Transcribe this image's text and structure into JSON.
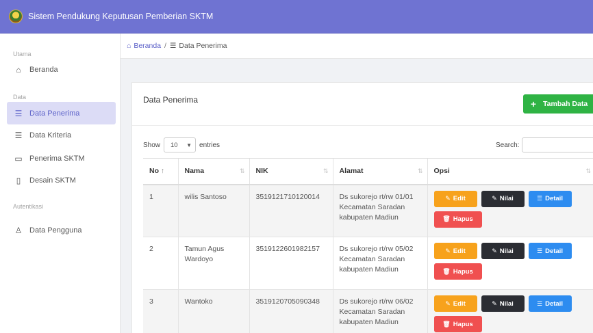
{
  "header": {
    "app_title": "Sistem Pendukung Keputusan Pemberian SKTM"
  },
  "sidebar": {
    "section_main": "Utama",
    "section_data": "Data",
    "section_auth": "Autentikasi",
    "items": [
      {
        "label": "Beranda",
        "icon": "home-icon"
      },
      {
        "label": "Data Penerima",
        "icon": "list-icon",
        "active": true
      },
      {
        "label": "Data Kriteria",
        "icon": "list-icon"
      },
      {
        "label": "Penerima SKTM",
        "icon": "calendar-icon"
      },
      {
        "label": "Desain SKTM",
        "icon": "file-icon"
      },
      {
        "label": "Data Pengguna",
        "icon": "user-icon"
      }
    ]
  },
  "breadcrumb": {
    "home": "Beranda",
    "separator": "/",
    "current": "Data Penerima"
  },
  "card": {
    "title": "Data Penerima",
    "add_button": "Tambah Data",
    "show_label": "Show",
    "entries_value": "10",
    "entries_label": "entries",
    "search_label": "Search:"
  },
  "table": {
    "columns": [
      "No",
      "Nama",
      "NIK",
      "Alamat",
      "Opsi"
    ],
    "action_labels": {
      "edit": "Edit",
      "nilai": "Nilai",
      "detail": "Detail",
      "hapus": "Hapus"
    },
    "rows": [
      {
        "no": "1",
        "nama": "wilis Santoso",
        "nik": "3519121710120014",
        "alamat": "Ds sukorejo rt/rw 01/01 Kecamatan Saradan kabupaten Madiun"
      },
      {
        "no": "2",
        "nama": "Tamun Agus Wardoyo",
        "nik": "3519122601982157",
        "alamat": "Ds sukorejo rt/rw 05/02 Kecamatan Saradan kabupaten Madiun"
      },
      {
        "no": "3",
        "nama": "Wantoko",
        "nik": "3519120705090348",
        "alamat": "Ds sukorejo rt/rw 06/02 Kecamatan Saradan kabupaten Madiun"
      }
    ]
  },
  "colors": {
    "topbar": "#6f73d2",
    "accent": "#5a5fc8",
    "add": "#2fb344",
    "edit": "#f7a21c",
    "nilai": "#2b2d33",
    "detail": "#2d8cf0",
    "hapus": "#f05050"
  }
}
